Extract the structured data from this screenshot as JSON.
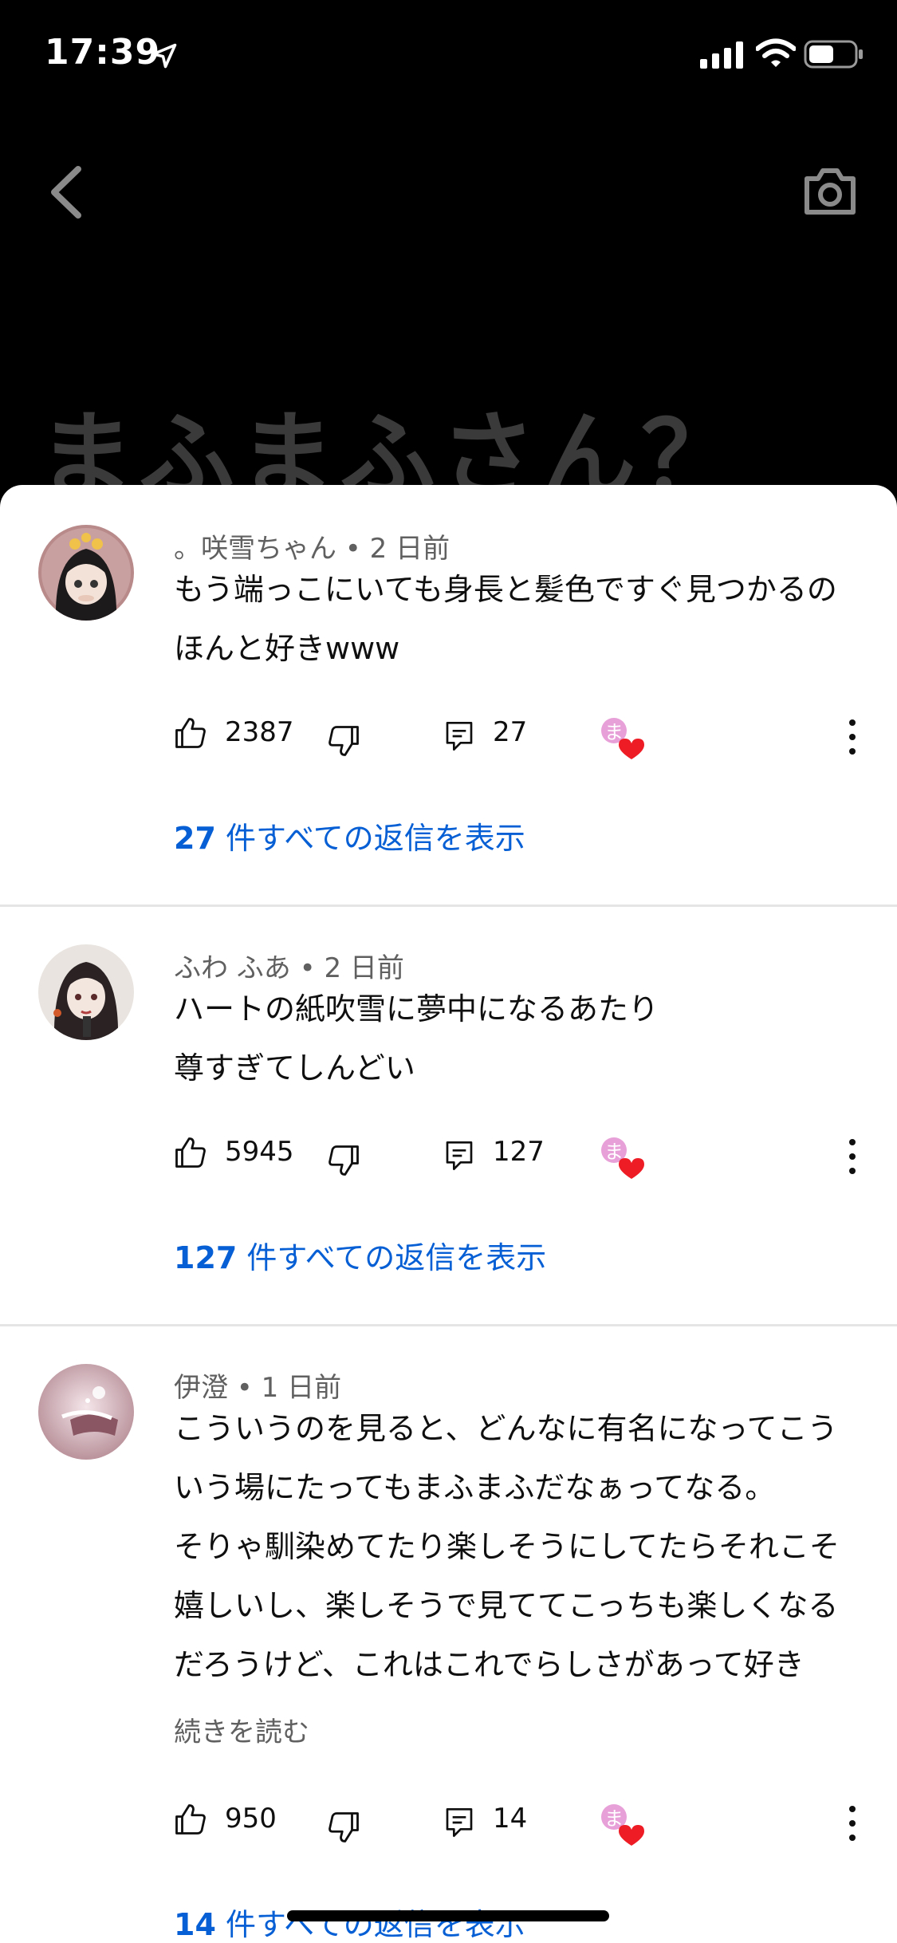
{
  "status_bar": {
    "time": "17:39"
  },
  "background_caption": "まふまふさん？",
  "comments": [
    {
      "author": "。咲雪ちゃん",
      "age": "2 日前",
      "lines": [
        "もう端っこにいても身長と髪色ですぐ見つかるの",
        "ほんと好きwww"
      ],
      "likes": "2387",
      "replies": "27",
      "view_replies_count": "27",
      "view_replies_label": "件すべての返信を表示"
    },
    {
      "author": "ふわ ふあ",
      "age": "2 日前",
      "lines": [
        "ハートの紙吹雪に夢中になるあたり",
        "尊すぎてしんどい"
      ],
      "likes": "5945",
      "replies": "127",
      "view_replies_count": "127",
      "view_replies_label": "件すべての返信を表示"
    },
    {
      "author": "伊澄",
      "age": "1 日前",
      "lines": [
        "こういうのを見ると、どんなに有名になってこう",
        "いう場にたってもまふまふだなぁってなる。",
        "そりゃ馴染めてたり楽しそうにしてたらそれこそ",
        "嬉しいし、楽しそうで見ててこっちも楽しくなる",
        "だろうけど、これはこれでらしさがあって好き"
      ],
      "read_more": "続きを読む",
      "likes": "950",
      "replies": "14",
      "view_replies_count": "14",
      "view_replies_label": "件すべての返信を表示"
    }
  ],
  "meta_separator": " • ",
  "colors": {
    "link": "#065fd4",
    "secondary_text": "#606060",
    "heart": "#ee1c25",
    "creator_badge": "#e8a0d8"
  }
}
